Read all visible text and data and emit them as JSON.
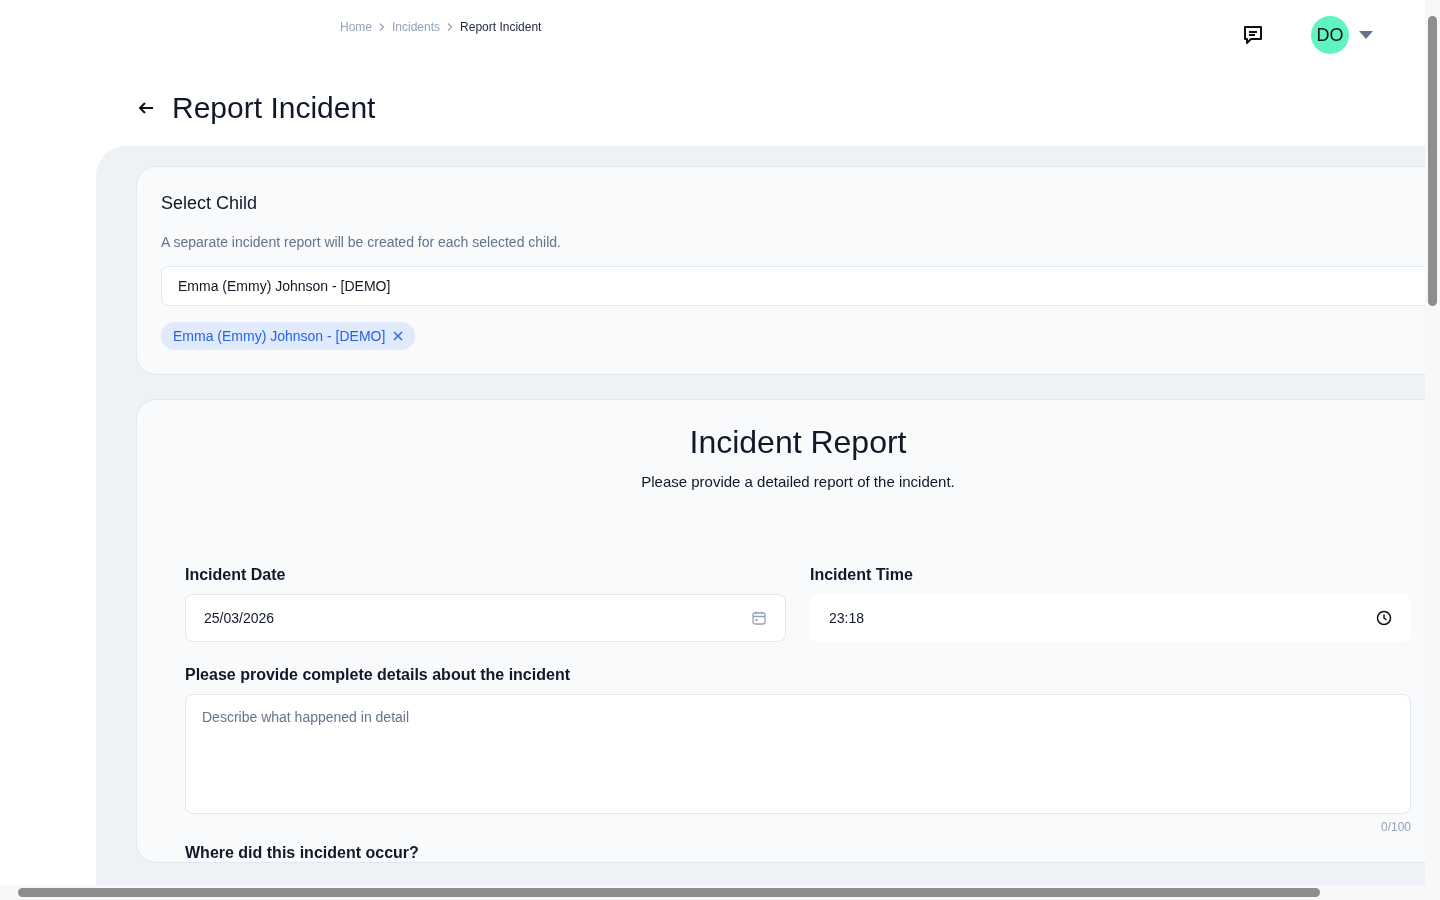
{
  "breadcrumb": [
    {
      "label": "Home",
      "current": false
    },
    {
      "label": "Incidents",
      "current": false
    },
    {
      "label": "Report Incident",
      "current": true
    }
  ],
  "header": {
    "avatar_initials": "DO"
  },
  "page_title": "Report Incident",
  "select_child": {
    "title": "Select Child",
    "hint": "A separate incident report will be created for each selected child.",
    "value": "Emma (Emmy) Johnson - [DEMO]",
    "chips": [
      {
        "label": "Emma (Emmy) Johnson - [DEMO]"
      }
    ]
  },
  "report": {
    "title": "Incident Report",
    "subtitle": "Please provide a detailed report of the incident.",
    "date": {
      "label": "Incident Date",
      "value": "25/03/2026"
    },
    "time": {
      "label": "Incident Time",
      "value": "23:18"
    },
    "details": {
      "label": "Please provide complete details about the incident",
      "placeholder": "Describe what happened in detail",
      "counter": "0/100"
    },
    "next_question": "Where did this incident occur?"
  }
}
